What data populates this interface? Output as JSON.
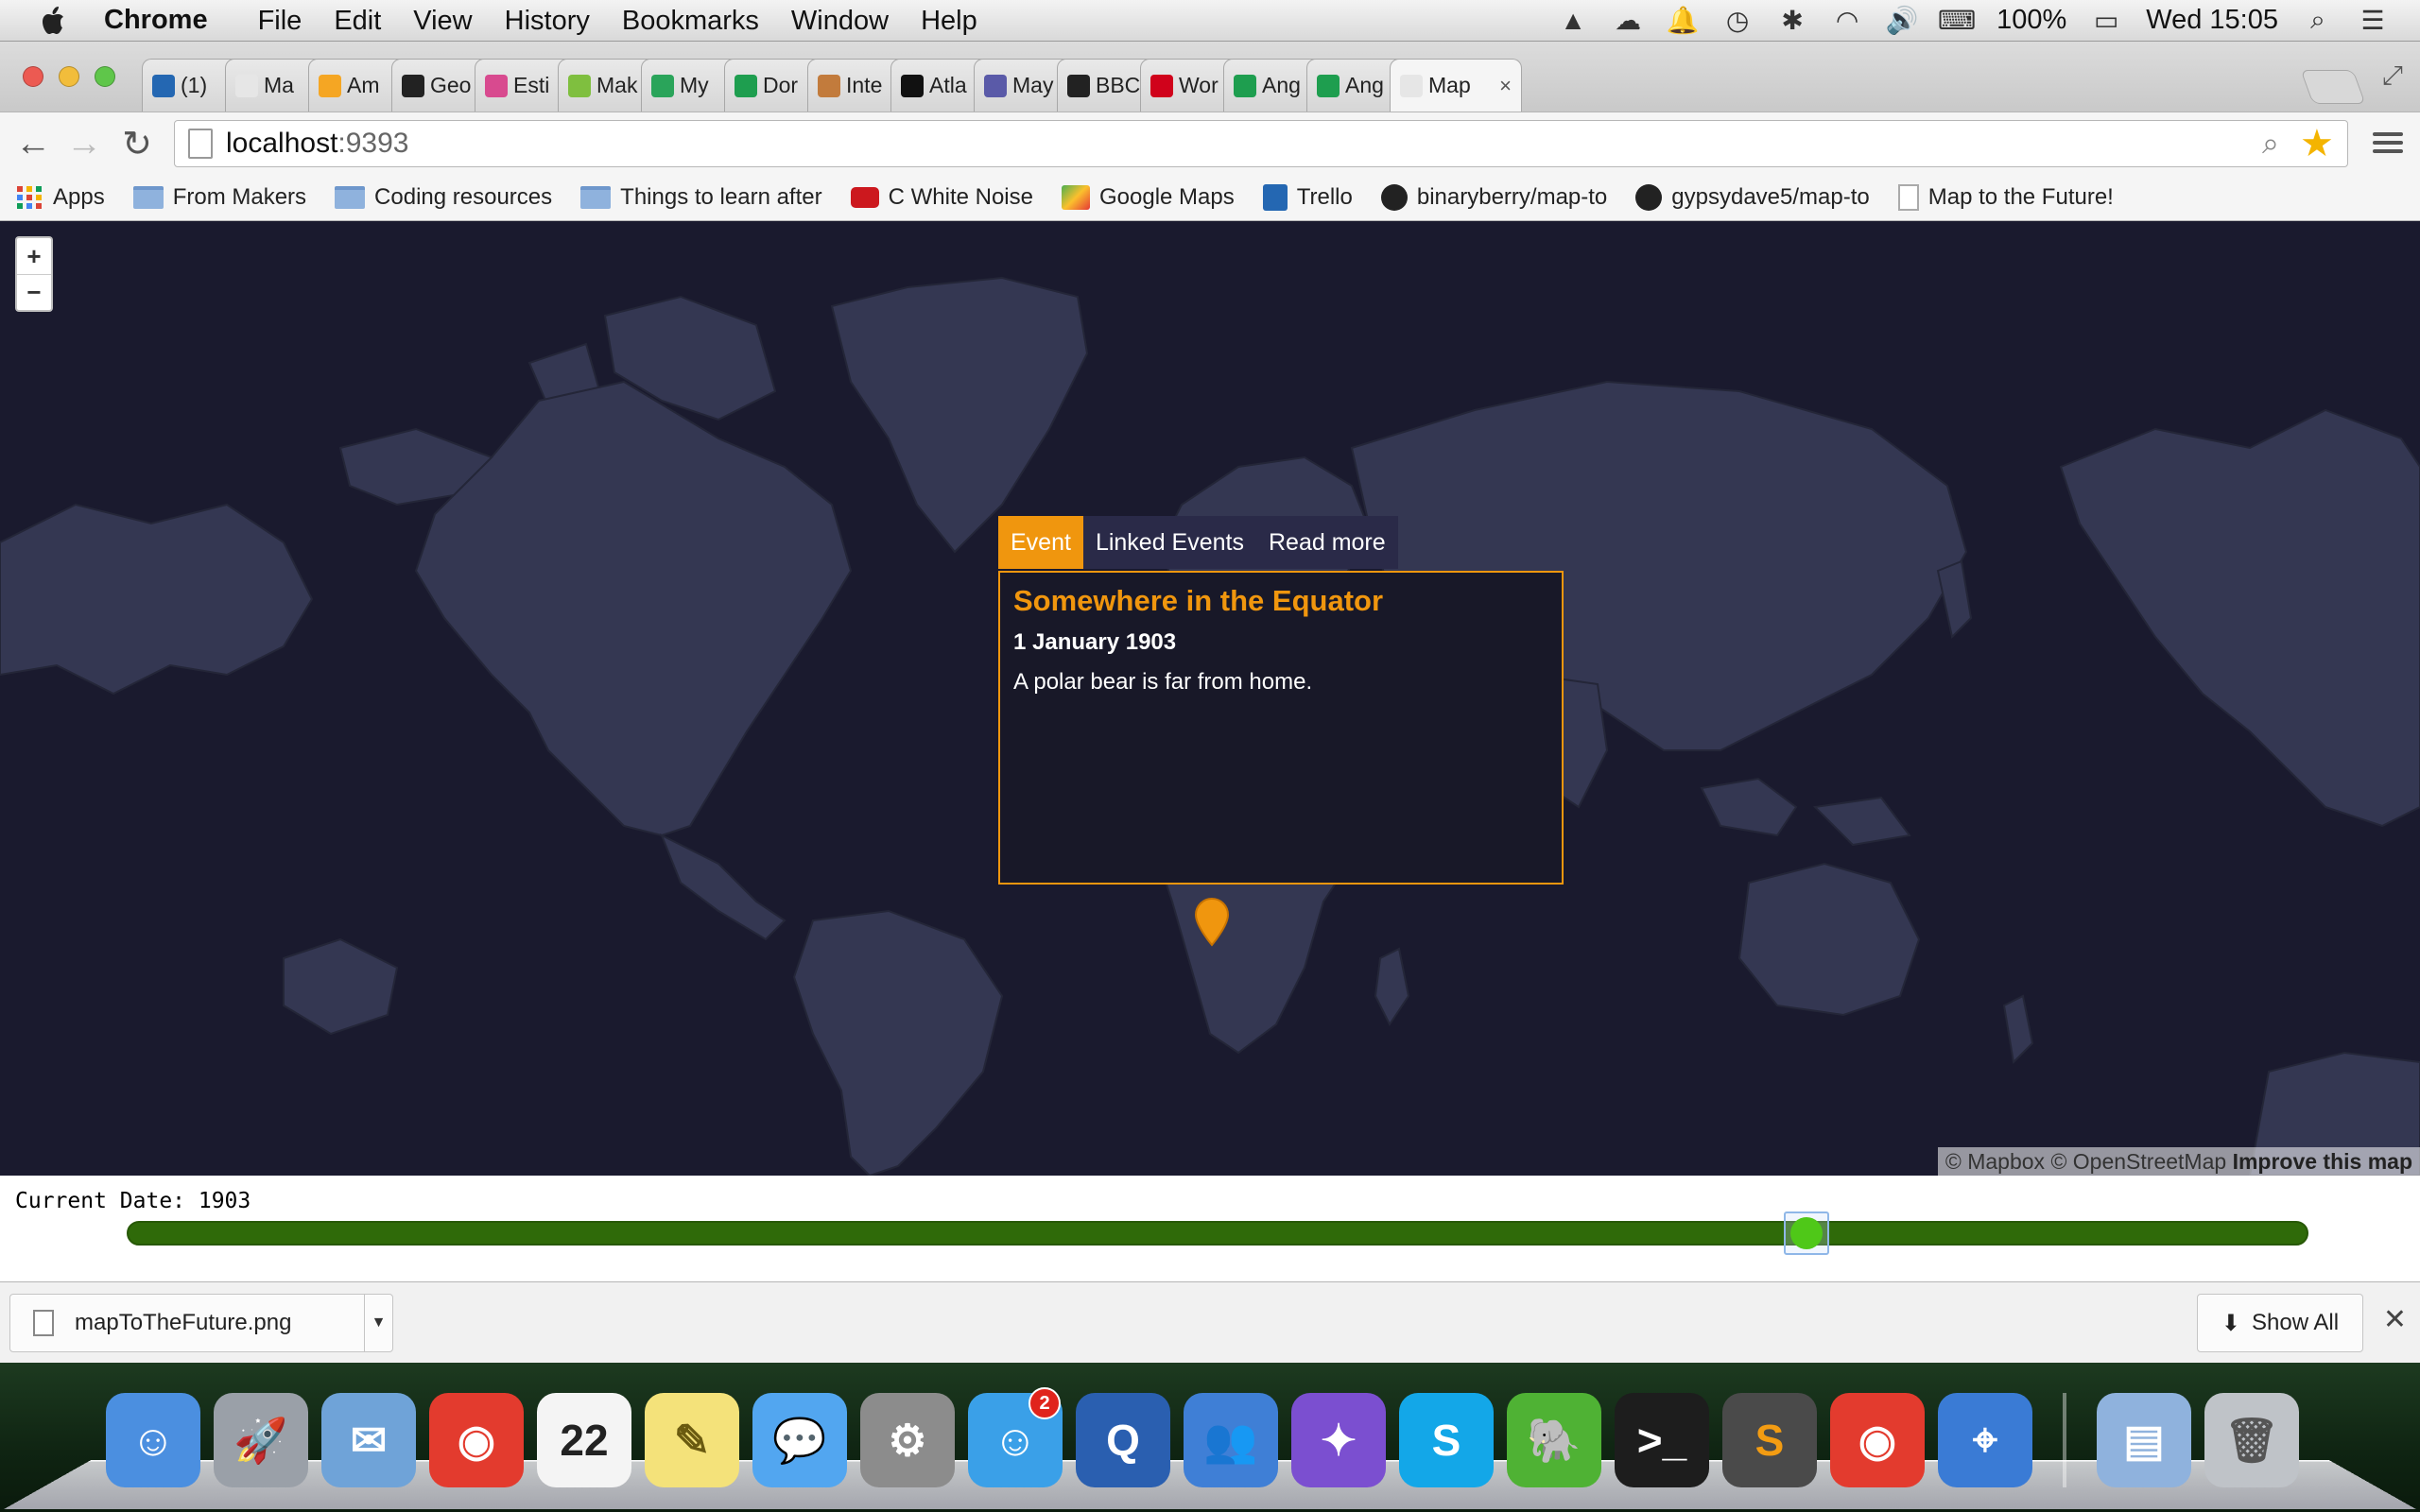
{
  "menubar": {
    "app_name": "Chrome",
    "items": [
      "File",
      "Edit",
      "View",
      "History",
      "Bookmarks",
      "Window",
      "Help"
    ],
    "battery": "100%",
    "clock": "Wed 15:05"
  },
  "tabs": [
    {
      "title": "(1)",
      "favicon": "trello",
      "color": "#2467b2"
    },
    {
      "title": "Ma",
      "favicon": "page",
      "color": "#e6e6e6"
    },
    {
      "title": "Am",
      "favicon": "box",
      "color": "#f5a623"
    },
    {
      "title": "Geo",
      "favicon": "github",
      "color": "#222222"
    },
    {
      "title": "Esti",
      "favicon": "pinwheel",
      "color": "#d84a8f"
    },
    {
      "title": "Mak",
      "favicon": "makers",
      "color": "#7fbf3f"
    },
    {
      "title": "My",
      "favicon": "drive",
      "color": "#2aa45a"
    },
    {
      "title": "Dor",
      "favicon": "sheets",
      "color": "#1e9e4f"
    },
    {
      "title": "Inte",
      "favicon": "photo",
      "color": "#c27b3c"
    },
    {
      "title": "Atla",
      "favicon": "fast-forward",
      "color": "#111111"
    },
    {
      "title": "May",
      "favicon": "bird",
      "color": "#5a5aa8"
    },
    {
      "title": "BBC",
      "favicon": "bbc",
      "color": "#222222"
    },
    {
      "title": "Wor",
      "favicon": "globe",
      "color": "#d0021b"
    },
    {
      "title": "Ang",
      "favicon": "sheets",
      "color": "#1e9e4f"
    },
    {
      "title": "Ang",
      "favicon": "sheets",
      "color": "#1e9e4f"
    },
    {
      "title": "Map",
      "favicon": "page",
      "color": "#e6e6e6",
      "active": true
    }
  ],
  "address": {
    "host": "localhost",
    "port": ":9393"
  },
  "bookmarks": [
    {
      "label": "Apps",
      "icon": "apps-grid"
    },
    {
      "label": "From Makers",
      "icon": "folder"
    },
    {
      "label": "Coding resources",
      "icon": "folder"
    },
    {
      "label": "Things to learn after",
      "icon": "folder"
    },
    {
      "label": "C White Noise",
      "icon": "youtube"
    },
    {
      "label": "Google Maps",
      "icon": "maps"
    },
    {
      "label": "Trello",
      "icon": "trello"
    },
    {
      "label": "binaryberry/map-to",
      "icon": "github"
    },
    {
      "label": "gypsydave5/map-to",
      "icon": "github"
    },
    {
      "label": "Map to the Future!",
      "icon": "page"
    }
  ],
  "map": {
    "zoom_in": "+",
    "zoom_out": "−",
    "popup": {
      "tabs": [
        "Event",
        "Linked Events",
        "Read more"
      ],
      "title": "Somewhere in the Equator",
      "date": "1 January 1903",
      "description": "A polar bear is far from home."
    },
    "attribution": {
      "mapbox": "© Mapbox",
      "osm": "© OpenStreetMap",
      "improve": "Improve this map"
    },
    "accent_color": "#f0960e",
    "land_color": "#343752",
    "water_color": "#1a1a2e"
  },
  "timeline": {
    "label": "Current Date: 1903",
    "slider_position": 0.77
  },
  "downloads": {
    "file": "mapToTheFuture.png",
    "show_all": "Show All"
  },
  "dock": [
    {
      "name": "finder",
      "glyph": "☺",
      "bg": "#4b8fe0"
    },
    {
      "name": "launchpad",
      "glyph": "🚀",
      "bg": "#9aa0a8"
    },
    {
      "name": "mail",
      "glyph": "✉",
      "bg": "#6fa3d8"
    },
    {
      "name": "chrome",
      "glyph": "◉",
      "bg": "#e33b2e"
    },
    {
      "name": "calendar",
      "glyph": "22",
      "bg": "#f4f4f4",
      "fg": "#222"
    },
    {
      "name": "notes",
      "glyph": "✎",
      "bg": "#f4e27a",
      "fg": "#6a5a10"
    },
    {
      "name": "messages",
      "glyph": "💬",
      "bg": "#52a6f0"
    },
    {
      "name": "system-preferences",
      "glyph": "⚙",
      "bg": "#8c8c8c"
    },
    {
      "name": "chat",
      "glyph": "☺",
      "bg": "#3aa0e8",
      "badge": "2"
    },
    {
      "name": "quicktime",
      "glyph": "Q",
      "bg": "#2a5fb0"
    },
    {
      "name": "contacts",
      "glyph": "👥",
      "bg": "#3f7fd6"
    },
    {
      "name": "app-store-helmet",
      "glyph": "✦",
      "bg": "#7b4fd0"
    },
    {
      "name": "skype",
      "glyph": "S",
      "bg": "#13a7e8"
    },
    {
      "name": "evernote",
      "glyph": "🐘",
      "bg": "#4fb234"
    },
    {
      "name": "terminal",
      "glyph": ">_",
      "bg": "#1d1d1d"
    },
    {
      "name": "sublime-text",
      "glyph": "S",
      "bg": "#4a4a4a",
      "fg": "#f39c12"
    },
    {
      "name": "chrome-2",
      "glyph": "◉",
      "bg": "#e33b2e"
    },
    {
      "name": "keynote",
      "glyph": "⌖",
      "bg": "#3a7bd5"
    },
    {
      "name": "downloads-folder",
      "glyph": "▤",
      "bg": "#8fb2dd"
    },
    {
      "name": "trash",
      "glyph": "🗑",
      "bg": "#bfc3c8",
      "fg": "#555"
    }
  ]
}
